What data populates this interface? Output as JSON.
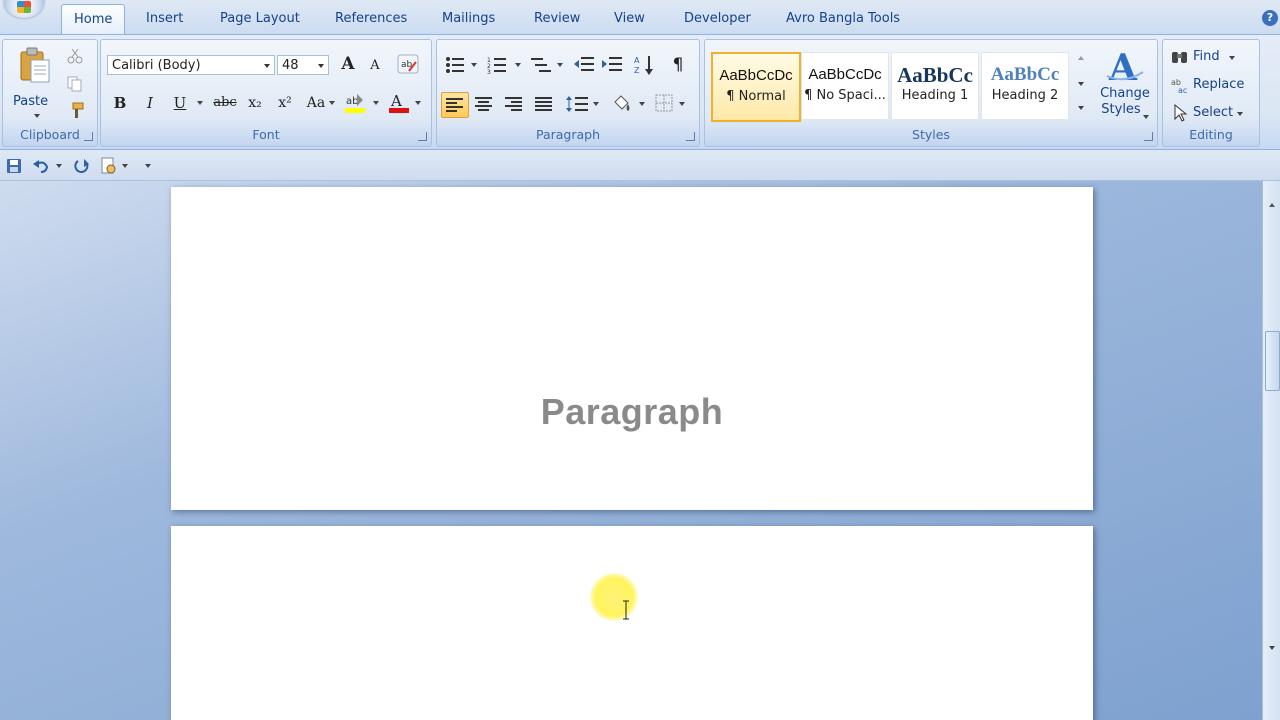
{
  "tabs": [
    {
      "label": "Home",
      "active": true
    },
    {
      "label": "Insert"
    },
    {
      "label": "Page Layout"
    },
    {
      "label": "References"
    },
    {
      "label": "Mailings"
    },
    {
      "label": "Review"
    },
    {
      "label": "View"
    },
    {
      "label": "Developer"
    },
    {
      "label": "Avro Bangla Tools"
    }
  ],
  "clipboard": {
    "paste_label": "Paste",
    "group_label": "Clipboard"
  },
  "font": {
    "family": "Calibri (Body)",
    "size": "48",
    "group_label": "Font",
    "bold": "B",
    "italic": "I",
    "underline": "U",
    "strike": "abc",
    "subscript": "x₂",
    "superscript": "x²",
    "change_case": "Aa",
    "grow": "A",
    "shrink": "A",
    "highlight_color": "#ffff00",
    "font_color": "#e01010"
  },
  "paragraph": {
    "group_label": "Paragraph",
    "show_marks": "¶"
  },
  "styles": {
    "group_label": "Styles",
    "items": [
      {
        "sample": "AaBbCcDc",
        "name": "¶ Normal",
        "selected": true
      },
      {
        "sample": "AaBbCcDc",
        "name": "¶ No Spaci..."
      },
      {
        "sample": "AaBbCc",
        "name": "Heading 1"
      },
      {
        "sample": "AaBbCc",
        "name": "Heading 2"
      }
    ],
    "change_label_1": "Change",
    "change_label_2": "Styles"
  },
  "editing": {
    "group_label": "Editing",
    "find": "Find",
    "replace": "Replace",
    "select": "Select"
  },
  "document": {
    "heading": "Paragraph"
  },
  "help": "?"
}
